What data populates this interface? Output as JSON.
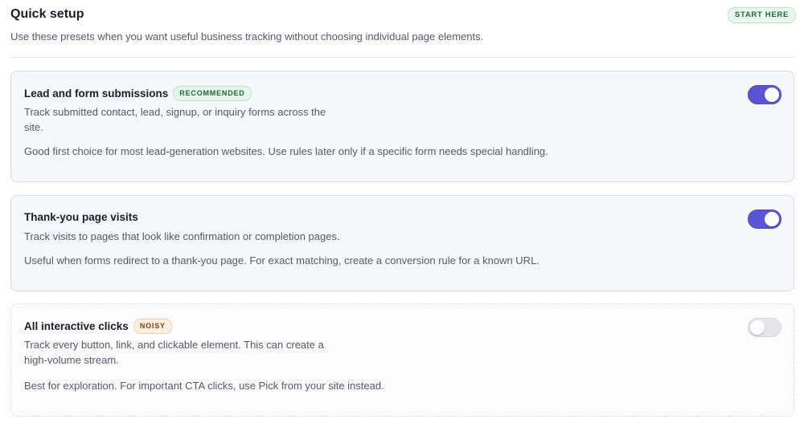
{
  "header": {
    "title": "Quick setup",
    "badge": "START HERE",
    "subtitle": "Use these presets when you want useful business tracking without choosing individual page elements."
  },
  "presets": [
    {
      "title": "Lead and form submissions",
      "tag": "RECOMMENDED",
      "description_line1": "Track submitted contact, lead, signup, or inquiry forms across the",
      "description_line2": "site.",
      "note": "Good first choice for most lead-generation websites. Use rules later only if a specific form needs special handling.",
      "enabled": true
    },
    {
      "title": "Thank-you page visits",
      "description_line1": "Track visits to pages that look like confirmation or completion pages.",
      "note": "Useful when forms redirect to a thank-you page. For exact matching, create a conversion rule for a known URL.",
      "enabled": true
    },
    {
      "title": "All interactive clicks",
      "tag": "NOISY",
      "description_line1": "Track every button, link, and clickable element. This can create a",
      "description_line2": "high-volume stream.",
      "note": "Best for exploration. For important CTA clicks, use Pick from your site instead.",
      "enabled": false
    }
  ],
  "colors": {
    "toggle_on": "#5a55d6",
    "toggle_off": "#e4e5e9",
    "tag_recommended": "#e6f4eb",
    "tag_noisy": "#fdf0e3"
  }
}
